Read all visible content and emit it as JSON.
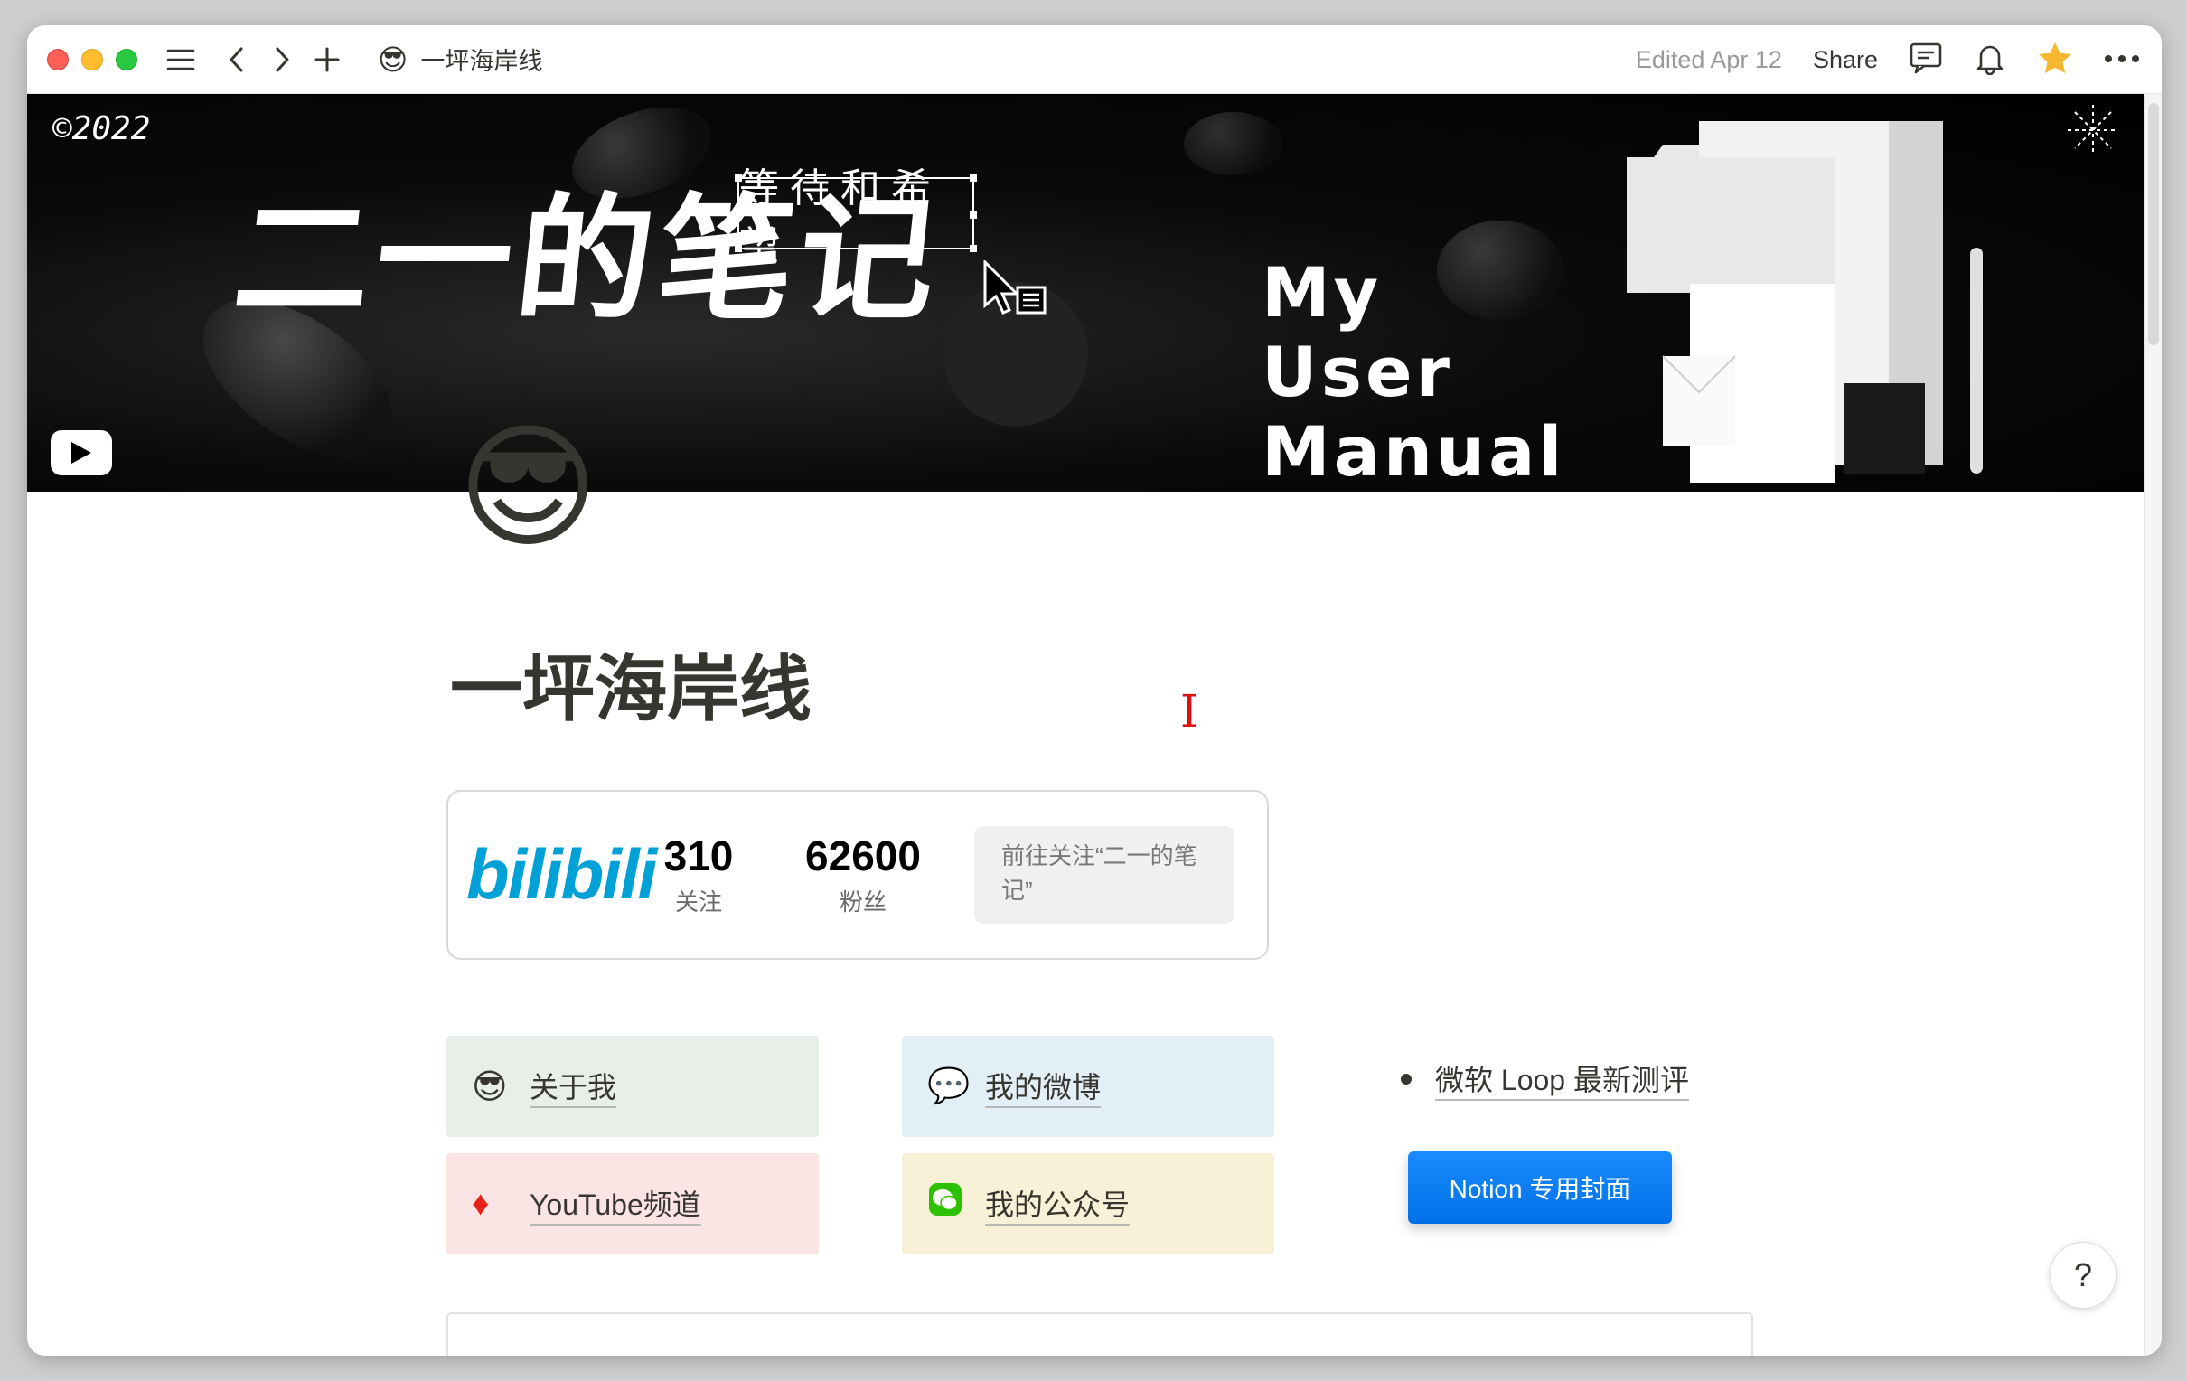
{
  "titlebar": {
    "page_emoji": "😎",
    "page_title": "一坪海岸线",
    "edited": "Edited Apr 12",
    "share": "Share"
  },
  "cover": {
    "copyright": "©2022",
    "title": "二一的笔记",
    "tagline": "等待和希望",
    "manual_line1": "My",
    "manual_line2": "User",
    "manual_line3": "Manual"
  },
  "page": {
    "emoji": "😎",
    "title": "一坪海岸线"
  },
  "bilibili": {
    "logo": "bilibili",
    "following_count": "310",
    "following_label": "关注",
    "followers_count": "62600",
    "followers_label": "粉丝",
    "follow_button": "前往关注“二一的笔记”"
  },
  "links": [
    {
      "icon": "😎",
      "label": "关于我",
      "color": "#e8efe9"
    },
    {
      "icon": "💬",
      "label": "我的微博",
      "color": "#e3eff6"
    },
    {
      "icon": "♦",
      "label": "YouTube频道",
      "color": "#fbe4e4"
    },
    {
      "icon": "💬",
      "label": "我的公众号",
      "color": "#f8f1d8"
    }
  ],
  "bullet": {
    "text": "微软 Loop 最新测评"
  },
  "notion_button": {
    "label": "Notion 专用封面"
  },
  "help": {
    "label": "?"
  }
}
